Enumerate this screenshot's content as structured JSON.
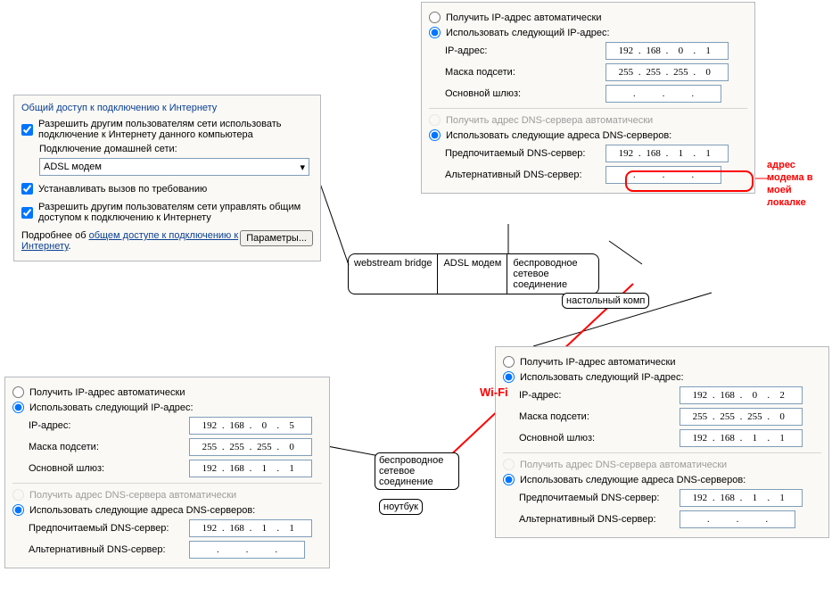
{
  "ics": {
    "title": "Общий доступ к подключению к Интернету",
    "cb1": "Разрешить другим пользователям сети использовать подключение к Интернету данного компьютера",
    "home_label": "Подключение домашней сети:",
    "home_value": "ADSL модем",
    "cb2": "Устанавливать вызов по требованию",
    "cb3": "Разрешить другим пользователям сети управлять общим доступом к подключению к Интернету",
    "more_prefix": "Подробнее об ",
    "more_link": "общем доступе к подключению к Интернету",
    "params_btn": "Параметры..."
  },
  "ip": {
    "auto_ip": "Получить IP-адрес автоматически",
    "manual_ip": "Использовать следующий IP-адрес:",
    "ip_addr": "IP-адрес:",
    "mask": "Маска подсети:",
    "gateway": "Основной шлюз:",
    "auto_dns": "Получить адрес DNS-сервера автоматически",
    "manual_dns": "Использовать следующие адреса DNS-серверов:",
    "dns1": "Предпочитаемый DNS-сервер:",
    "dns2": "Альтернативный DNS-сервер:"
  },
  "desk": {
    "ip": [
      "192",
      "168",
      "0",
      "1"
    ],
    "mask": [
      "255",
      "255",
      "255",
      "0"
    ],
    "dns": [
      "192",
      "168",
      "1",
      "1"
    ]
  },
  "right": {
    "ip": [
      "192",
      "168",
      "0",
      "2"
    ],
    "mask": [
      "255",
      "255",
      "255",
      "0"
    ],
    "gw": [
      "192",
      "168",
      "1",
      "1"
    ],
    "dns": [
      "192",
      "168",
      "1",
      "1"
    ]
  },
  "laptop": {
    "ip": [
      "192",
      "168",
      "0",
      "5"
    ],
    "mask": [
      "255",
      "255",
      "255",
      "0"
    ],
    "gw": [
      "192",
      "168",
      "1",
      "1"
    ],
    "dns": [
      "192",
      "168",
      "1",
      "1"
    ]
  },
  "nodes": {
    "three_1": "webstream bridge",
    "three_2": "ADSL модем",
    "three_3": "беспроводное сетевое соединение",
    "desktop_tag": "настольный комп",
    "wifi_tag": "Wi-Fi",
    "wireless_box": "беспроводное сетевое соединение",
    "laptop_tag": "ноутбук",
    "callout_text": "адрес модема в моей локалке"
  }
}
